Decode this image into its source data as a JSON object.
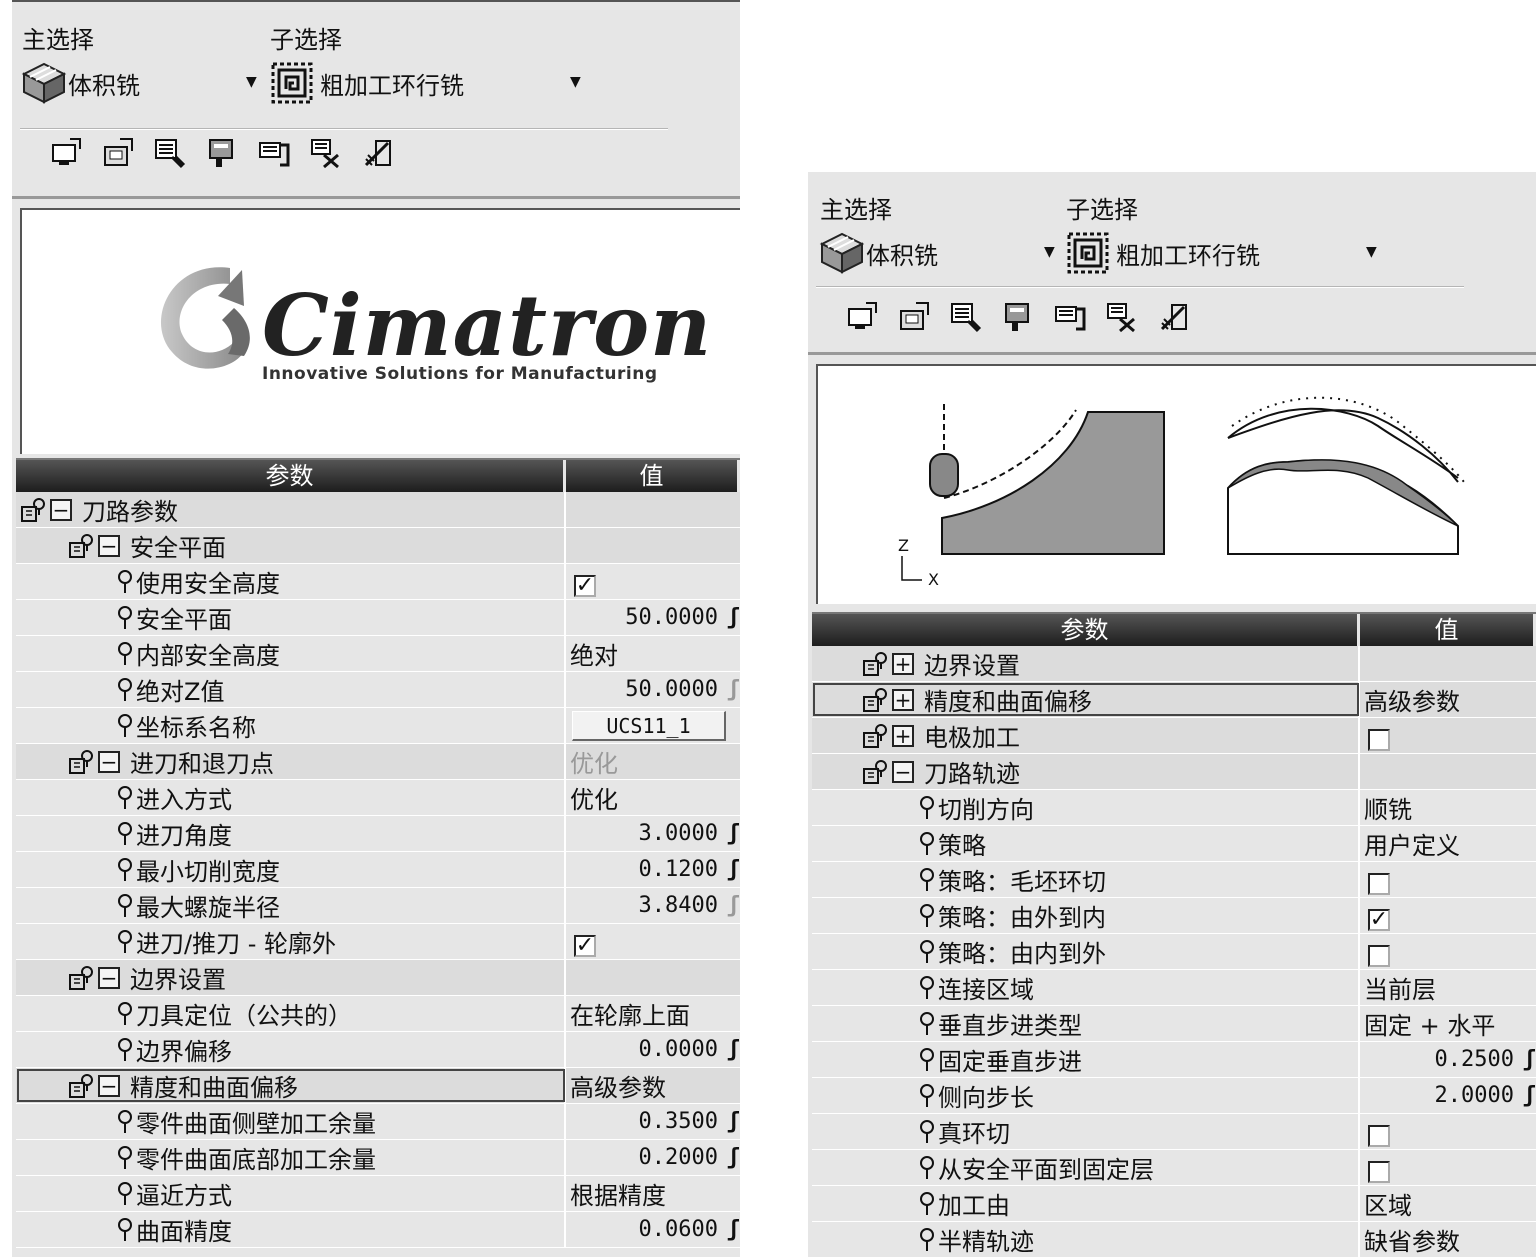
{
  "left": {
    "main_select_label": "主选择",
    "sub_select_label": "子选择",
    "main_select_value": "体积铣",
    "sub_select_value": "粗加工环行铣",
    "logo": {
      "name": "Cimatron",
      "tagline": "Innovative Solutions for Manufacturing"
    },
    "grid": {
      "col_param": "参数",
      "col_value": "值",
      "rows": [
        {
          "level": 0,
          "type": "group",
          "expanded": true,
          "label": "刀路参数",
          "value": ""
        },
        {
          "level": 1,
          "type": "group",
          "expanded": true,
          "label": "安全平面",
          "value": ""
        },
        {
          "level": 2,
          "type": "check",
          "label": "使用安全高度",
          "value": "✓"
        },
        {
          "level": 2,
          "type": "num",
          "label": "安全平面",
          "value": "50.0000"
        },
        {
          "level": 2,
          "type": "text",
          "label": "内部安全高度",
          "value": "绝对"
        },
        {
          "level": 2,
          "type": "numdim",
          "label": "绝对Z值",
          "value": "50.0000"
        },
        {
          "level": 2,
          "type": "button",
          "label": "坐标系名称",
          "value": "UCS11_1"
        },
        {
          "level": 1,
          "type": "group",
          "expanded": true,
          "label": "进刀和退刀点",
          "value": "优化",
          "dim": true
        },
        {
          "level": 2,
          "type": "text",
          "label": "进入方式",
          "value": "优化"
        },
        {
          "level": 2,
          "type": "num",
          "label": "进刀角度",
          "value": "3.0000"
        },
        {
          "level": 2,
          "type": "num",
          "label": "最小切削宽度",
          "value": "0.1200"
        },
        {
          "level": 2,
          "type": "numdim",
          "label": "最大螺旋半径",
          "value": "3.8400"
        },
        {
          "level": 2,
          "type": "check",
          "label": "进刀/推刀 - 轮廓外",
          "value": "✓"
        },
        {
          "level": 1,
          "type": "group",
          "expanded": true,
          "label": "边界设置",
          "value": ""
        },
        {
          "level": 2,
          "type": "text",
          "label": "刀具定位（公共的）",
          "value": "在轮廓上面"
        },
        {
          "level": 2,
          "type": "num",
          "label": "边界偏移",
          "value": "0.0000"
        },
        {
          "level": 1,
          "type": "group",
          "expanded": true,
          "label": "精度和曲面偏移",
          "value": "高级参数",
          "focus": true
        },
        {
          "level": 2,
          "type": "num",
          "label": "零件曲面侧壁加工余量",
          "value": "0.3500"
        },
        {
          "level": 2,
          "type": "num",
          "label": "零件曲面底部加工余量",
          "value": "0.2000"
        },
        {
          "level": 2,
          "type": "text",
          "label": "逼近方式",
          "value": "根据精度"
        },
        {
          "level": 2,
          "type": "num",
          "label": "曲面精度",
          "value": "0.0600"
        }
      ]
    }
  },
  "right": {
    "main_select_label": "主选择",
    "sub_select_label": "子选择",
    "main_select_value": "体积铣",
    "sub_select_value": "粗加工环行铣",
    "axis": {
      "z": "Z",
      "x": "X"
    },
    "grid": {
      "col_param": "参数",
      "col_value": "值",
      "rows": [
        {
          "level": 0,
          "type": "group",
          "expanded": false,
          "label": "边界设置",
          "value": ""
        },
        {
          "level": 0,
          "type": "group",
          "expanded": false,
          "label": "精度和曲面偏移",
          "value": "高级参数",
          "focus": true
        },
        {
          "level": 0,
          "type": "groupcheck",
          "expanded": false,
          "label": "电极加工",
          "value": ""
        },
        {
          "level": 0,
          "type": "group",
          "expanded": true,
          "label": "刀路轨迹",
          "value": ""
        },
        {
          "level": 1,
          "type": "text",
          "label": "切削方向",
          "value": "顺铣"
        },
        {
          "level": 1,
          "type": "text",
          "label": "策略",
          "value": "用户定义"
        },
        {
          "level": 1,
          "type": "check",
          "label": "策略：毛坯环切",
          "value": ""
        },
        {
          "level": 1,
          "type": "check",
          "label": "策略：由外到内",
          "value": "✓"
        },
        {
          "level": 1,
          "type": "check",
          "label": "策略：由内到外",
          "value": ""
        },
        {
          "level": 1,
          "type": "text",
          "label": "连接区域",
          "value": "当前层"
        },
        {
          "level": 1,
          "type": "text",
          "label": "垂直步进类型",
          "value": "固定 + 水平"
        },
        {
          "level": 1,
          "type": "num",
          "label": "固定垂直步进",
          "value": "0.2500"
        },
        {
          "level": 1,
          "type": "num",
          "label": "侧向步长",
          "value": "2.0000"
        },
        {
          "level": 1,
          "type": "check",
          "label": "真环切",
          "value": ""
        },
        {
          "level": 1,
          "type": "check",
          "label": "从安全平面到固定层",
          "value": ""
        },
        {
          "level": 1,
          "type": "text",
          "label": "加工由",
          "value": "区域"
        },
        {
          "level": 1,
          "type": "text",
          "label": "半精轨迹",
          "value": "缺省参数"
        }
      ]
    }
  },
  "icons": [
    "cube-icon",
    "spiral-icon",
    "dropdown-arrow-icon",
    "toolbar-icons",
    "pin-icon",
    "group-icon",
    "expand-icon",
    "collapse-icon"
  ]
}
